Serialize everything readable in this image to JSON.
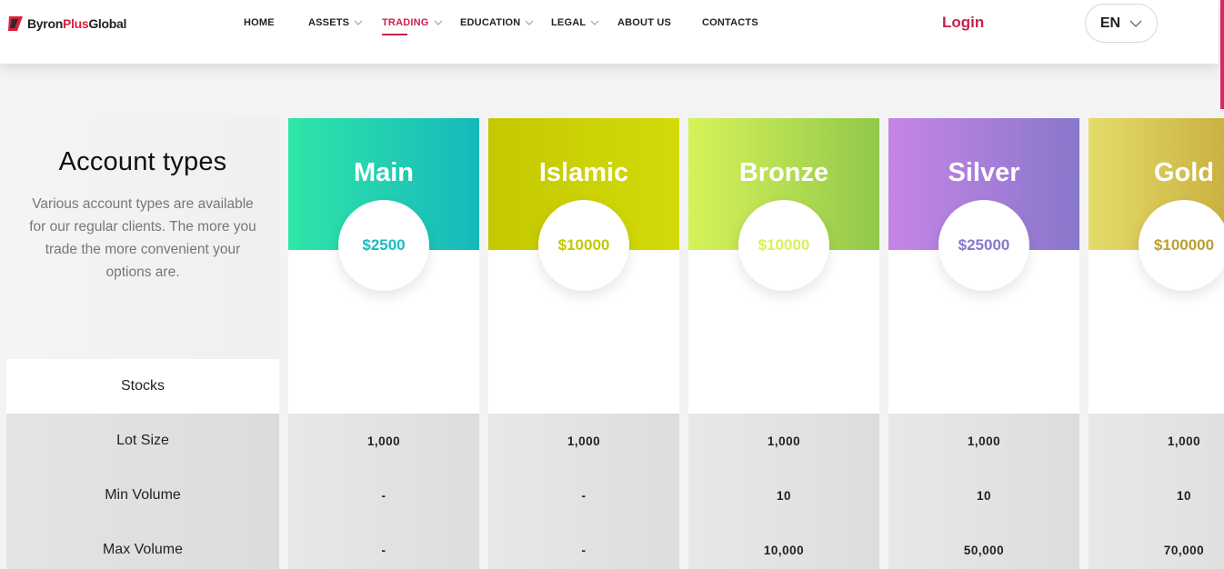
{
  "header": {
    "logo": {
      "part1": "Byron",
      "part2": "Plus",
      "part3": "Global",
      "accent_color": "#d91f3c"
    },
    "nav": [
      {
        "label": "HOME",
        "dropdown": false,
        "active": false
      },
      {
        "label": "ASSETS",
        "dropdown": true,
        "active": false
      },
      {
        "label": "TRADING",
        "dropdown": true,
        "active": true
      },
      {
        "label": "EDUCATION",
        "dropdown": true,
        "active": false
      },
      {
        "label": "LEGAL",
        "dropdown": true,
        "active": false
      },
      {
        "label": "ABOUT US",
        "dropdown": false,
        "active": false
      },
      {
        "label": "CONTACTS",
        "dropdown": false,
        "active": false
      }
    ],
    "login_label": "Login",
    "language": "EN",
    "accent_color": "#c8234d"
  },
  "intro": {
    "title": "Account types",
    "description": "Various account types are available for our regular clients. The more you trade the more convenient your options are."
  },
  "row_labels": {
    "stocks": "Stocks",
    "lot_size": "Lot Size",
    "min_volume": "Min Volume",
    "max_volume": "Max Volume"
  },
  "accounts": [
    {
      "name": "Main",
      "price": "$2500",
      "lot_size": "1,000",
      "min_volume": "-",
      "max_volume": "-",
      "gradient": [
        "#2fe6a8",
        "#16b8bc"
      ],
      "price_color": "#1cbcbf"
    },
    {
      "name": "Islamic",
      "price": "$10000",
      "lot_size": "1,000",
      "min_volume": "-",
      "max_volume": "-",
      "gradient": [
        "#c4c800",
        "#d2db0a"
      ],
      "price_color": "#c4c800"
    },
    {
      "name": "Bronze",
      "price": "$10000",
      "lot_size": "1,000",
      "min_volume": "10",
      "max_volume": "10,000",
      "gradient": [
        "#d6f25a",
        "#92c84a"
      ],
      "price_color": "#d6f25a"
    },
    {
      "name": "Silver",
      "price": "$25000",
      "lot_size": "1,000",
      "min_volume": "10",
      "max_volume": "50,000",
      "gradient": [
        "#c685e6",
        "#8877cc"
      ],
      "price_color": "#8877cc"
    },
    {
      "name": "Gold",
      "price": "$100000",
      "lot_size": "1,000",
      "min_volume": "10",
      "max_volume": "70,000",
      "gradient": [
        "#e4dc6a",
        "#c0a030"
      ],
      "price_color": "#b8a030"
    }
  ]
}
